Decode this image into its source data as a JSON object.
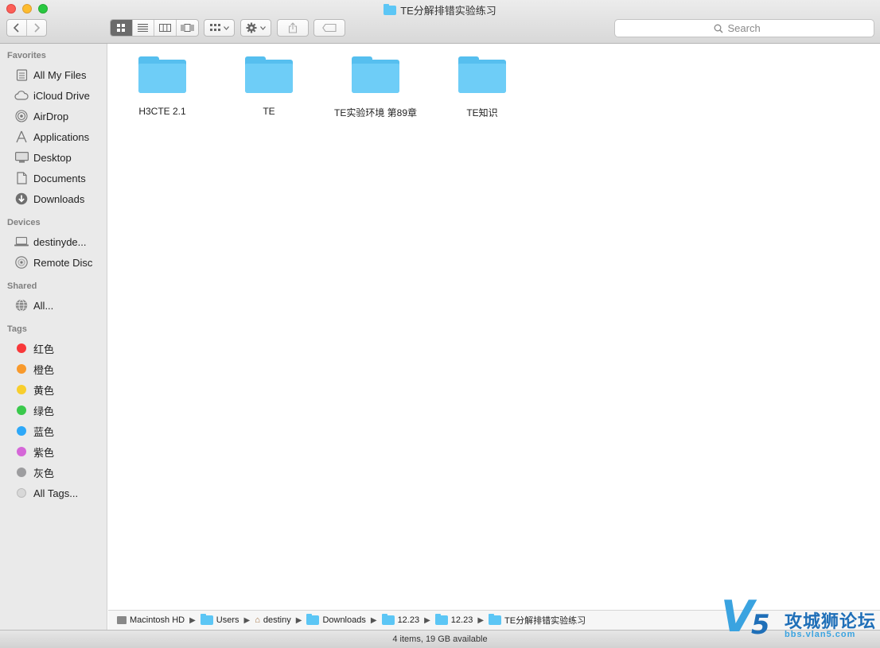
{
  "window": {
    "title": "TE分解排错实验练习"
  },
  "toolbar": {
    "back_icon": "chevron-left-icon",
    "forward_icon": "chevron-right-icon",
    "search": {
      "placeholder": "Search"
    }
  },
  "sidebar": {
    "favorites_heading": "Favorites",
    "favorites": [
      {
        "label": "All My Files",
        "icon": "all-files-icon"
      },
      {
        "label": "iCloud Drive",
        "icon": "cloud-icon"
      },
      {
        "label": "AirDrop",
        "icon": "airdrop-icon"
      },
      {
        "label": "Applications",
        "icon": "applications-icon"
      },
      {
        "label": "Desktop",
        "icon": "desktop-icon"
      },
      {
        "label": "Documents",
        "icon": "document-icon"
      },
      {
        "label": "Downloads",
        "icon": "downloads-icon"
      }
    ],
    "devices_heading": "Devices",
    "devices": [
      {
        "label": "destinyde...",
        "icon": "laptop-icon"
      },
      {
        "label": "Remote Disc",
        "icon": "disc-icon"
      }
    ],
    "shared_heading": "Shared",
    "shared": [
      {
        "label": "All...",
        "icon": "network-icon"
      }
    ],
    "tags_heading": "Tags",
    "tags": [
      {
        "label": "红色",
        "color": "#f8383a"
      },
      {
        "label": "橙色",
        "color": "#f89a2c"
      },
      {
        "label": "黄色",
        "color": "#f8ce2d"
      },
      {
        "label": "绿色",
        "color": "#3ac94c"
      },
      {
        "label": "蓝色",
        "color": "#2ea8f8"
      },
      {
        "label": "紫色",
        "color": "#d567d8"
      },
      {
        "label": "灰色",
        "color": "#9d9d9f"
      },
      {
        "label": "All Tags...",
        "color": "#d8d8d8"
      }
    ]
  },
  "content": {
    "folders": [
      {
        "name": "H3CTE 2.1"
      },
      {
        "name": "TE"
      },
      {
        "name": "TE实验环境 第89章"
      },
      {
        "name": "TE知识"
      }
    ]
  },
  "pathbar": {
    "crumbs": [
      {
        "label": "Macintosh HD",
        "icon": "hard-drive-icon"
      },
      {
        "label": "Users",
        "icon": "folder-icon"
      },
      {
        "label": "destiny",
        "icon": "home-icon"
      },
      {
        "label": "Downloads",
        "icon": "downloads-folder-icon"
      },
      {
        "label": "12.23",
        "icon": "folder-icon"
      },
      {
        "label": "12.23",
        "icon": "folder-icon"
      },
      {
        "label": "TE分解排错实验练习",
        "icon": "folder-icon"
      }
    ]
  },
  "statusbar": {
    "text": "4 items, 19 GB available"
  },
  "watermark": {
    "logo_letters": "V5",
    "site_name": "攻城狮论坛",
    "url": "bbs.vlan5.com"
  }
}
